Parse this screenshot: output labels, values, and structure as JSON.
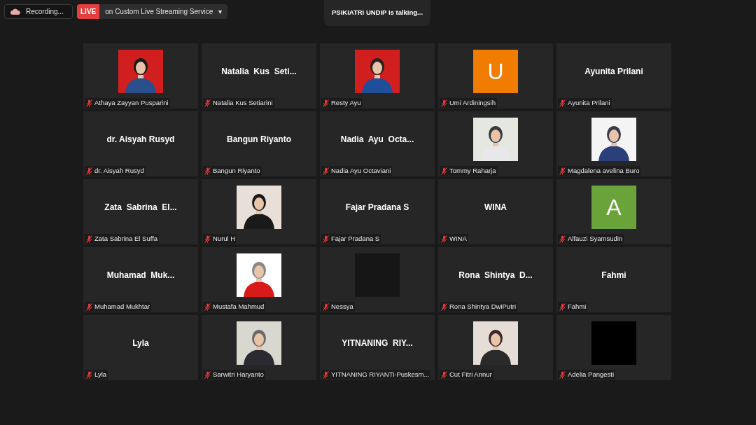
{
  "recording": {
    "label": "Recording..."
  },
  "live": {
    "badge": "LIVE",
    "service": "on Custom Live Streaming Service",
    "caret": "▾"
  },
  "talking": "PSIKIATRI UNDIP is talking...",
  "tiles": [
    {
      "kind": "picture",
      "name": "Athaya Zayyan Pusparini",
      "muted": true
    },
    {
      "kind": "name",
      "title": "Natalia  Kus  Seti...",
      "name": "Natalia Kus Setiarini",
      "muted": true
    },
    {
      "kind": "picture",
      "name": "Resty Ayu",
      "muted": true
    },
    {
      "kind": "initial",
      "title": "U",
      "color": "#f07c00",
      "name": "Umi Ardiningsih",
      "muted": true
    },
    {
      "kind": "name",
      "title": "Ayunita Prilani",
      "name": "Ayunita Prilani",
      "muted": true
    },
    {
      "kind": "name",
      "title": "dr. Aisyah Rusyd",
      "name": "dr. Aisyah Rusyd",
      "muted": true
    },
    {
      "kind": "name",
      "title": "Bangun Riyanto",
      "name": "Bangun Riyanto",
      "muted": true
    },
    {
      "kind": "name",
      "title": "Nadia  Ayu  Octa...",
      "name": "Nadia Ayu Octaviani",
      "muted": true
    },
    {
      "kind": "picture",
      "name": "Tommy Raharja",
      "muted": true
    },
    {
      "kind": "picture",
      "name": "Magdalena avelina Buro",
      "muted": true
    },
    {
      "kind": "name",
      "title": "Zata  Sabrina  El...",
      "name": "Zata Sabrina El Suffa",
      "muted": true
    },
    {
      "kind": "picture",
      "name": "Nurul H",
      "muted": true
    },
    {
      "kind": "name",
      "title": "Fajar Pradana S",
      "name": "Fajar Pradana S",
      "muted": true
    },
    {
      "kind": "name",
      "title": "WINA",
      "name": "WINA",
      "muted": true
    },
    {
      "kind": "initial",
      "title": "A",
      "color": "#6aa33a",
      "name": "Alfauzi Syamsudin",
      "muted": true
    },
    {
      "kind": "name",
      "title": "Muhamad  Muk...",
      "name": "Muhamad Mukhtar",
      "muted": true
    },
    {
      "kind": "picture",
      "name": "Mustafa Mahmud",
      "muted": true
    },
    {
      "kind": "blank",
      "color": "#161616",
      "name": "Nessya",
      "muted": true
    },
    {
      "kind": "name",
      "title": "Rona  Shintya  D...",
      "name": "Rona Shintya DwiPutri",
      "muted": true
    },
    {
      "kind": "name",
      "title": "Fahmi",
      "name": "Fahmi",
      "muted": true
    },
    {
      "kind": "name",
      "title": "Lyla",
      "name": "Lyla",
      "muted": true
    },
    {
      "kind": "picture",
      "name": "Sarwitri Haryanto",
      "muted": true
    },
    {
      "kind": "name",
      "title": "YITNANING  RIY...",
      "name": "YITNANING RIYANTi-Puskesm...",
      "muted": true
    },
    {
      "kind": "picture",
      "name": "Cut Fitri Annur",
      "muted": true
    },
    {
      "kind": "blank",
      "color": "#000000",
      "name": "Adelia Pangesti",
      "muted": true
    }
  ]
}
